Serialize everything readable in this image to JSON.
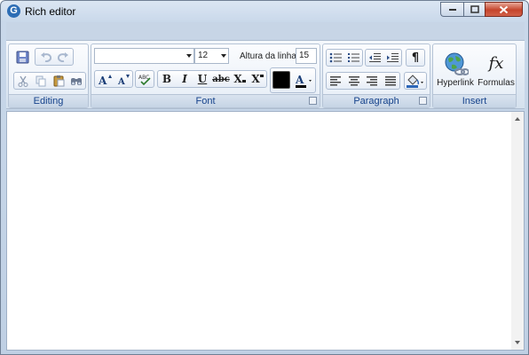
{
  "window": {
    "title": "Rich editor",
    "app_icon_letter": "G"
  },
  "ribbon": {
    "groups": {
      "editing": "Editing",
      "font": "Font",
      "paragraph": "Paragraph",
      "insert": "Insert"
    },
    "font": {
      "font_name": "",
      "font_size": "12",
      "line_height_label": "Altura da linha:",
      "line_height_value": "15",
      "bold": "B",
      "italic": "I",
      "underline": "U",
      "strikethrough": "abc",
      "subscript_base": "X",
      "superscript_base": "X",
      "font_color": "#000000",
      "text_color_glyph": "A"
    },
    "paragraph": {
      "pilcrow": "¶"
    },
    "insert": {
      "hyperlink_label": "Hyperlink",
      "formulas_label": "Formulas",
      "formulas_glyph": "fx"
    }
  },
  "colors": {
    "accent": "#15428b",
    "close_button": "#c5452c"
  }
}
